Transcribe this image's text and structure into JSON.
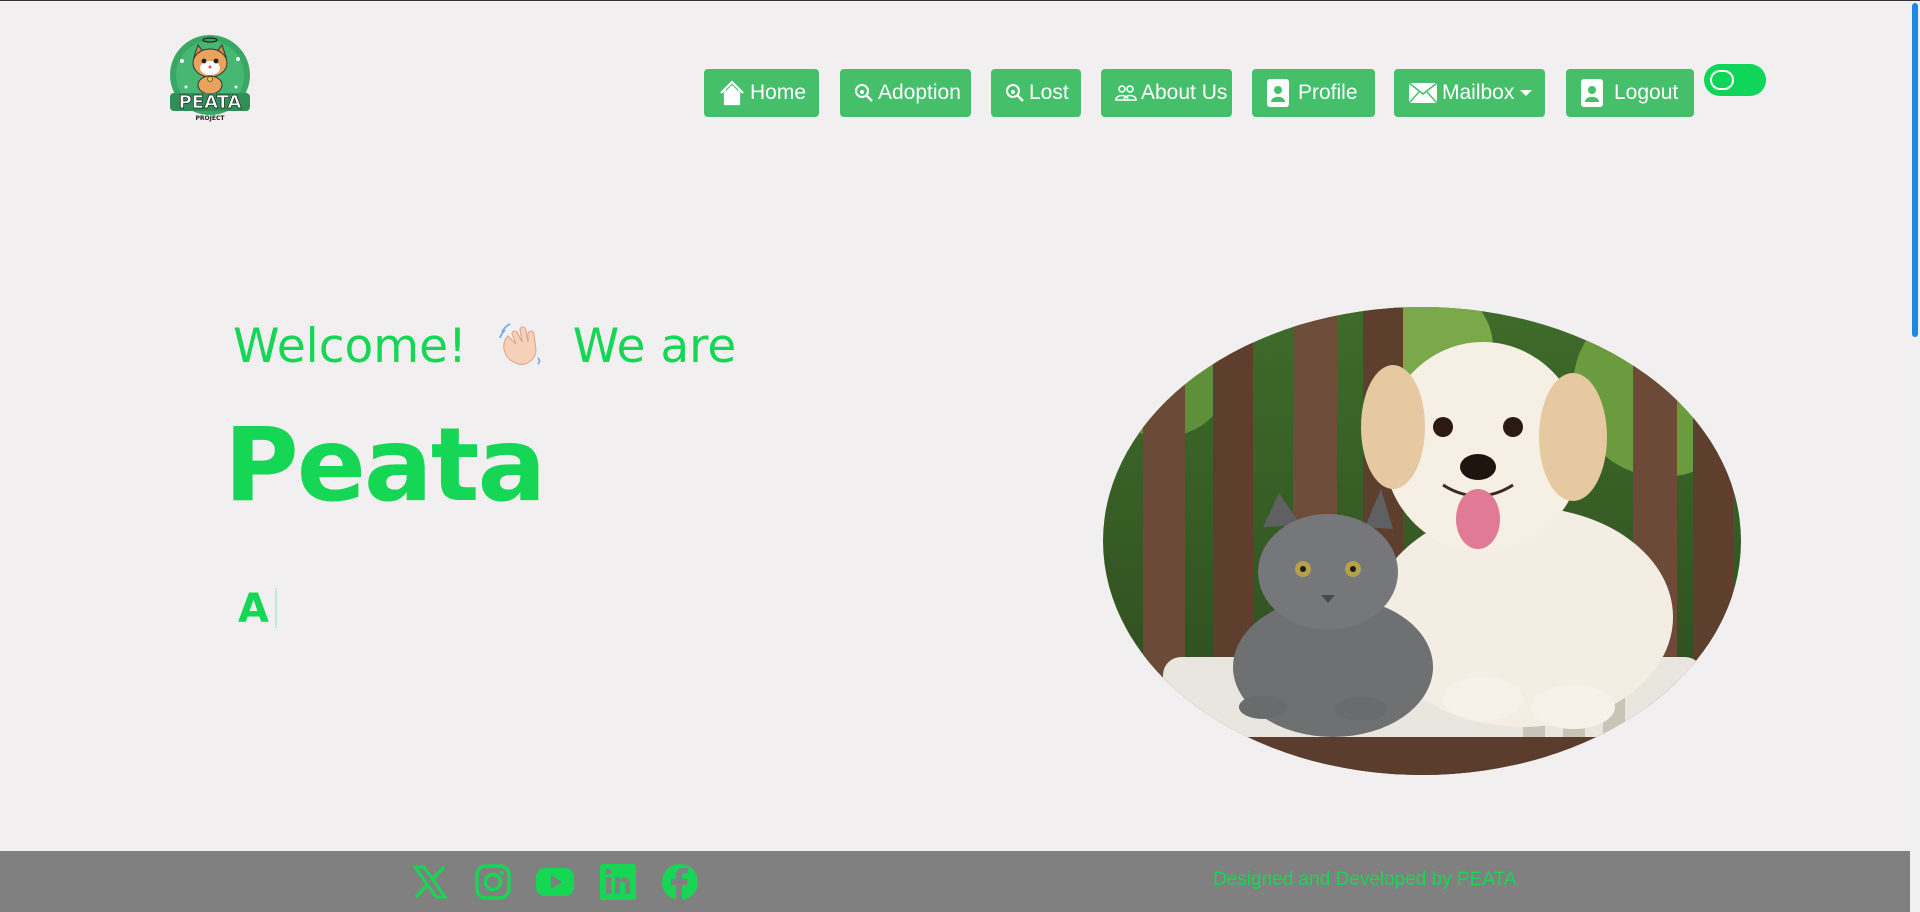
{
  "logo": {
    "brand_text": "PEATA",
    "sub_text": "PROJECT",
    "icon": "cat-logo-icon"
  },
  "nav": {
    "items": [
      {
        "label": "Home",
        "icon": "home-icon"
      },
      {
        "label": "Adoption",
        "icon": "search-pet-icon"
      },
      {
        "label": "Lost",
        "icon": "search-pet-icon"
      },
      {
        "label": "About Us",
        "icon": "people-icon"
      },
      {
        "label": "Profile",
        "icon": "profile-card-icon"
      },
      {
        "label": "Mailbox",
        "icon": "envelope-icon",
        "dropdown": true
      },
      {
        "label": "Logout",
        "icon": "profile-card-icon"
      }
    ],
    "theme_toggle": {
      "state": "on"
    }
  },
  "hero": {
    "welcome_pre": "Welcome!",
    "welcome_post": "We are",
    "wave_icon": "waving-hand-icon",
    "brand": "Peata",
    "typed_text": "A",
    "image": "puppy-and-kitten-photo"
  },
  "footer": {
    "social": [
      "x-icon",
      "instagram-icon",
      "youtube-icon",
      "linkedin-icon",
      "facebook-icon"
    ],
    "credit": "Designed and Developed by PEATA"
  },
  "colors": {
    "brand_green": "#15d655",
    "button_green": "#45bf6a",
    "background": "#f2eff0",
    "footer_gray": "#808080",
    "scroll_thumb": "#1e88e5"
  }
}
